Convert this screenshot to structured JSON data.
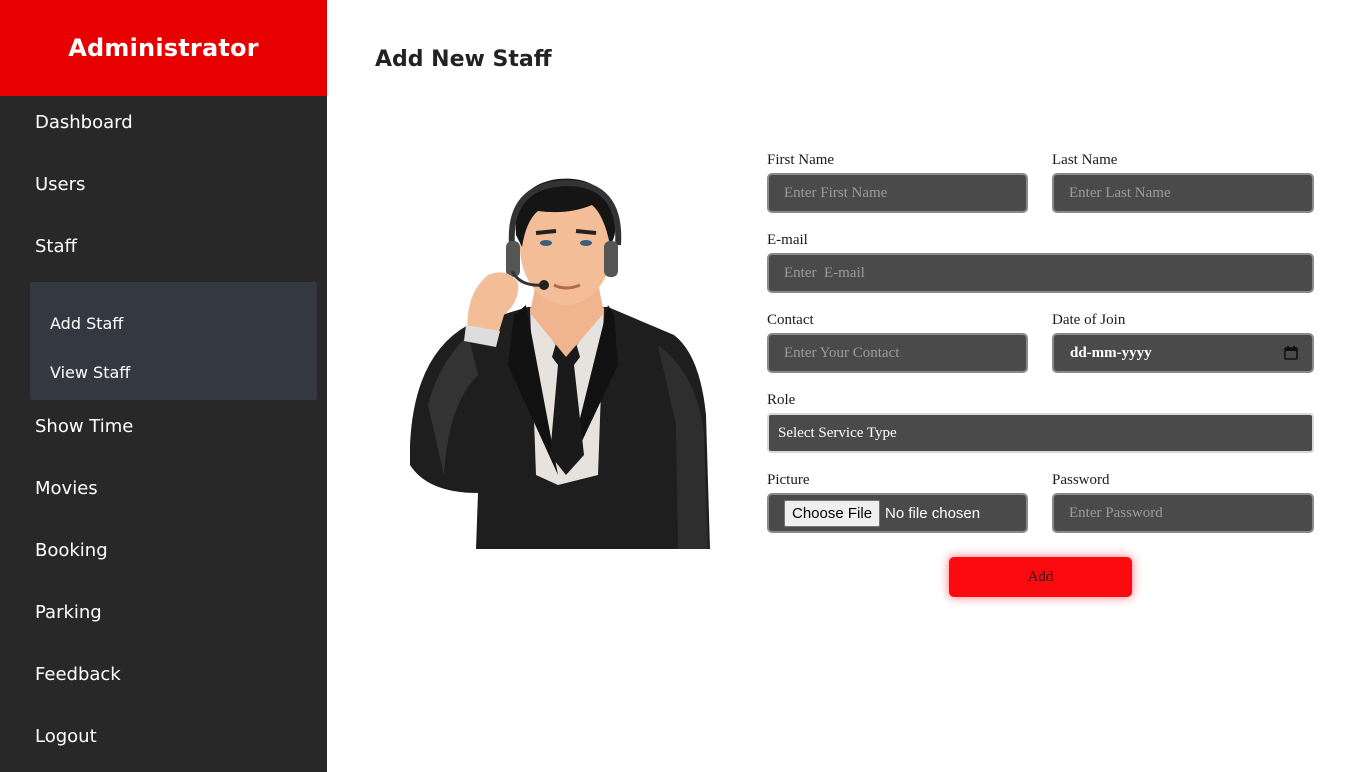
{
  "sidebar": {
    "title": "Administrator",
    "items": [
      {
        "label": "Dashboard"
      },
      {
        "label": "Users"
      },
      {
        "label": "Staff"
      },
      {
        "label": "Show Time"
      },
      {
        "label": "Movies"
      },
      {
        "label": "Booking"
      },
      {
        "label": "Parking"
      },
      {
        "label": "Feedback"
      },
      {
        "label": "Logout"
      }
    ],
    "staff_submenu": [
      {
        "label": "Add Staff"
      },
      {
        "label": "View Staff"
      }
    ]
  },
  "main": {
    "title": "Add New Staff",
    "illustration_icon": "staff-with-headset-illustration"
  },
  "form": {
    "first_name": {
      "label": "First Name",
      "placeholder": "Enter First Name"
    },
    "last_name": {
      "label": "Last Name",
      "placeholder": "Enter Last Name"
    },
    "email": {
      "label": "E-mail",
      "placeholder": "Enter  E-mail"
    },
    "contact": {
      "label": "Contact",
      "placeholder": "Enter Your Contact"
    },
    "date_of_join": {
      "label": "Date of Join",
      "value": "dd-mm-yyyy",
      "icon": "calendar-icon"
    },
    "role": {
      "label": "Role",
      "selected": "Select Service Type"
    },
    "picture": {
      "label": "Picture",
      "button": "Choose File",
      "status": "No file chosen"
    },
    "password": {
      "label": "Password",
      "placeholder": "Enter Password"
    },
    "submit_label": "Add"
  },
  "colors": {
    "brand": "#e80000",
    "sidebar_bg": "#282828",
    "submenu_bg": "#343841",
    "input_bg": "#4a4a4a",
    "button": "#fb0a10"
  }
}
